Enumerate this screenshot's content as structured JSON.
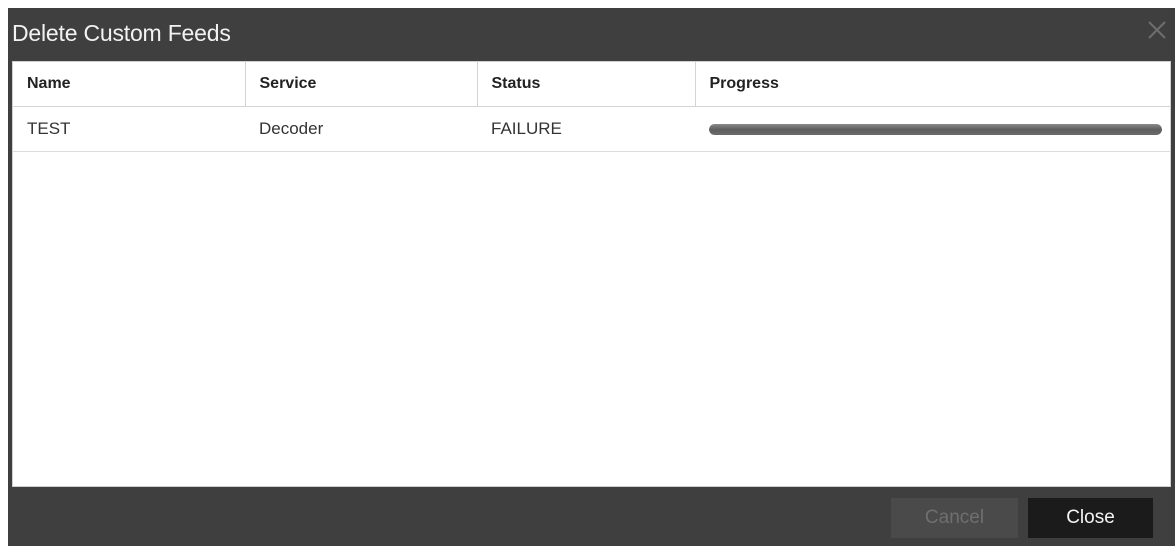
{
  "dialog": {
    "title": "Delete Custom Feeds",
    "close_icon": "close-icon"
  },
  "table": {
    "columns": [
      "Name",
      "Service",
      "Status",
      "Progress"
    ],
    "rows": [
      {
        "name": "TEST",
        "service": "Decoder",
        "status": "FAILURE",
        "progress": 1.0
      }
    ]
  },
  "footer": {
    "cancel_label": "Cancel",
    "close_label": "Close",
    "cancel_disabled": true
  }
}
